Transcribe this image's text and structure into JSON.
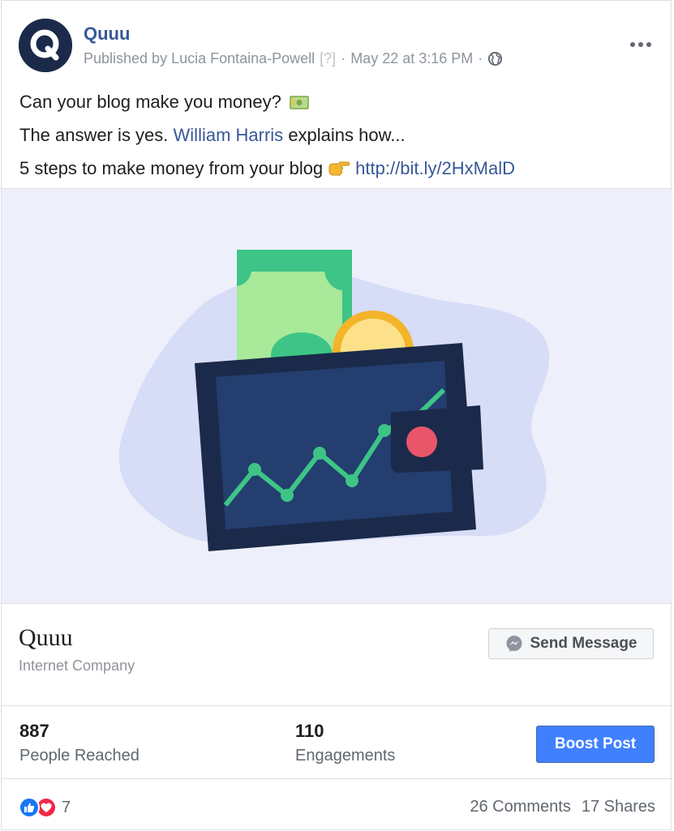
{
  "post": {
    "page_name": "Quuu",
    "avatar_letter": "Q",
    "published_by": "Published by Lucia Fontaina-Powell",
    "help_marker": "[?]",
    "separator": "·",
    "timestamp": "May 22 at 3:16 PM",
    "lines": {
      "line1": "Can your blog make you money?",
      "line2_prefix": "The answer is yes.",
      "line2_mention": "William Harris",
      "line2_suffix": "explains how...",
      "line3_prefix": "5 steps to make money from your blog",
      "line3_link": "http://bit.ly/2HxMalD"
    }
  },
  "cta": {
    "name": "Quuu",
    "category": "Internet Company",
    "button_label": "Send Message"
  },
  "stats": {
    "reached_value": "887",
    "reached_label": "People Reached",
    "engagements_value": "110",
    "engagements_label": "Engagements",
    "boost_label": "Boost Post"
  },
  "footer": {
    "reaction_count": "7",
    "comments": "26 Comments",
    "shares": "17 Shares"
  },
  "colors": {
    "brand_link": "#385898",
    "boost_blue": "#4080ff",
    "like_blue": "#1877f2",
    "love_red": "#f0284a",
    "hero_bg": "#edf0fb",
    "wallet_navy": "#1b2a4a",
    "chart_green": "#3ec487"
  },
  "icons": [
    "more-options-icon",
    "globe-icon",
    "money-emoji-icon",
    "pointing-hand-emoji-icon",
    "messenger-icon",
    "like-reaction-icon",
    "love-reaction-icon"
  ]
}
